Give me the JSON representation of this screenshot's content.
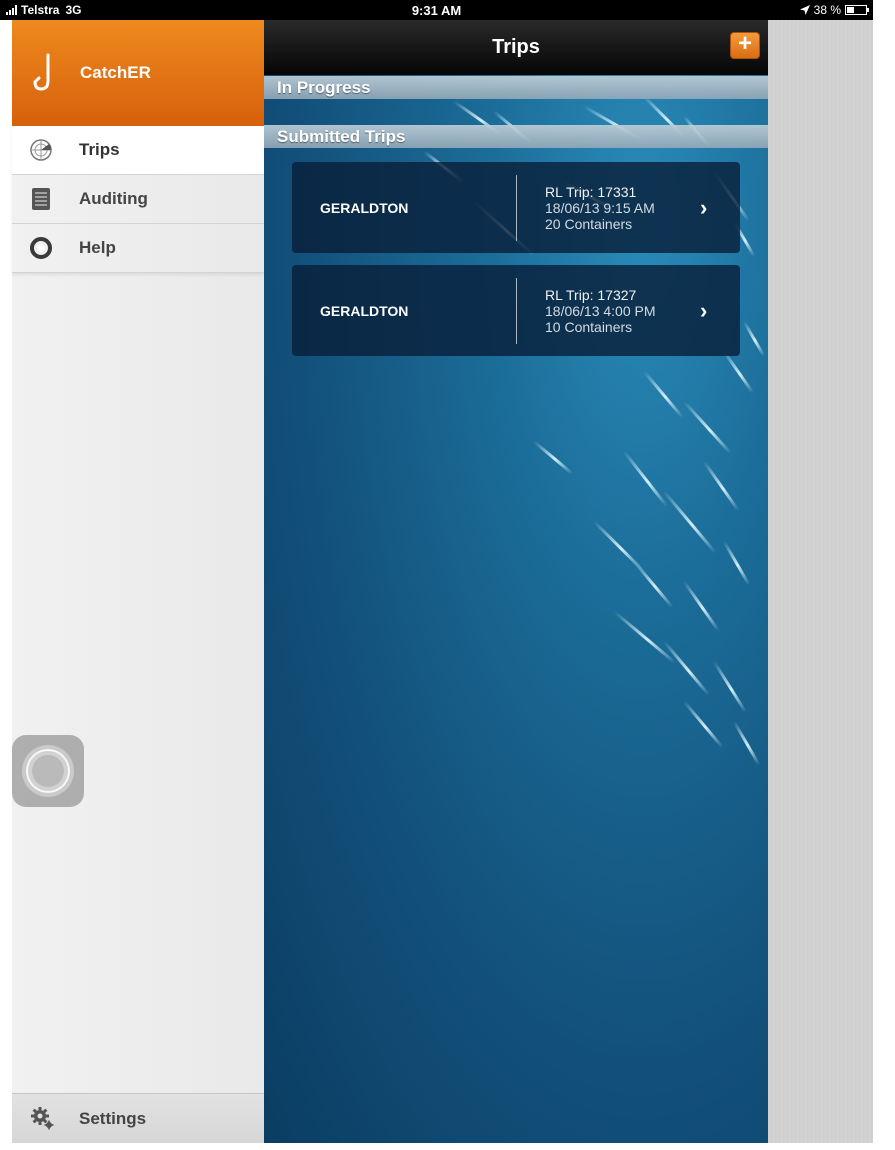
{
  "status_bar": {
    "carrier": "Telstra",
    "network": "3G",
    "time": "9:31 AM",
    "battery": "38 %"
  },
  "sidebar": {
    "app_name": "CatchER",
    "items": [
      {
        "label": "Trips",
        "icon": "radar-icon",
        "active": true
      },
      {
        "label": "Auditing",
        "icon": "document-icon",
        "active": false
      },
      {
        "label": "Help",
        "icon": "lifebuoy-icon",
        "active": false
      }
    ],
    "settings_label": "Settings"
  },
  "main": {
    "title": "Trips",
    "add_button": "+",
    "sections": {
      "in_progress": "In Progress",
      "submitted": "Submitted Trips"
    },
    "trips": [
      {
        "location": "GERALDTON",
        "trip": "RL Trip: 17331",
        "datetime": "18/06/13 9:15 AM",
        "containers": "20 Containers",
        "chevron": "›"
      },
      {
        "location": "GERALDTON",
        "trip": "RL Trip: 17327",
        "datetime": "18/06/13 4:00 PM",
        "containers": "10 Containers",
        "chevron": "›"
      }
    ]
  },
  "colors": {
    "brand_orange": "#e4741a",
    "nav_bar": "#111111",
    "ocean": "#12507a"
  }
}
